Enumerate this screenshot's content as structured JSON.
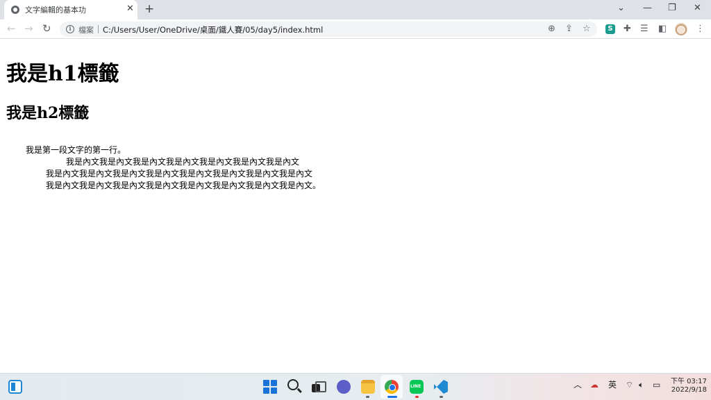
{
  "browser": {
    "tab_title": "文字編輯的基本功",
    "tab_close": "✕",
    "new_tab": "+",
    "window": {
      "dropdown": "⌄",
      "minimize": "—",
      "restore": "❐",
      "close": "✕"
    },
    "nav": {
      "back": "←",
      "forward": "→",
      "reload": "↻"
    },
    "omnibox": {
      "security_label": "檔案",
      "url": "C:/Users/User/OneDrive/桌面/鐵人賽/05/day5/index.html"
    },
    "icons": [
      "zoom-icon",
      "share-icon",
      "star-icon",
      "extension-s-icon",
      "puzzle-icon",
      "reading-list-icon",
      "side-panel-icon",
      "profile-avatar",
      "menu-icon"
    ],
    "ext_s_label": "S"
  },
  "page": {
    "h1": "我是h1標籤",
    "h2": "我是h2標籤",
    "paragraph_lines": [
      "我是第一段文字的第一行。",
      "我是內文我是內文我是內文我是內文我是內文我是內文我是內文",
      "我是內文我是內文我是內文我是內文我是內文我是內文我是內文我是內文",
      "我是內文我是內文我是內文我是內文我是內文我是內文我是內文我是內文。"
    ]
  },
  "taskbar": {
    "tray": {
      "chevron": "︿",
      "ime": "英"
    },
    "time": "下午 03:17",
    "date": "2022/9/18",
    "colors": {
      "running_chrome": "#1a73e8",
      "running_other": "#5f6368",
      "running_line": "#e33"
    }
  }
}
